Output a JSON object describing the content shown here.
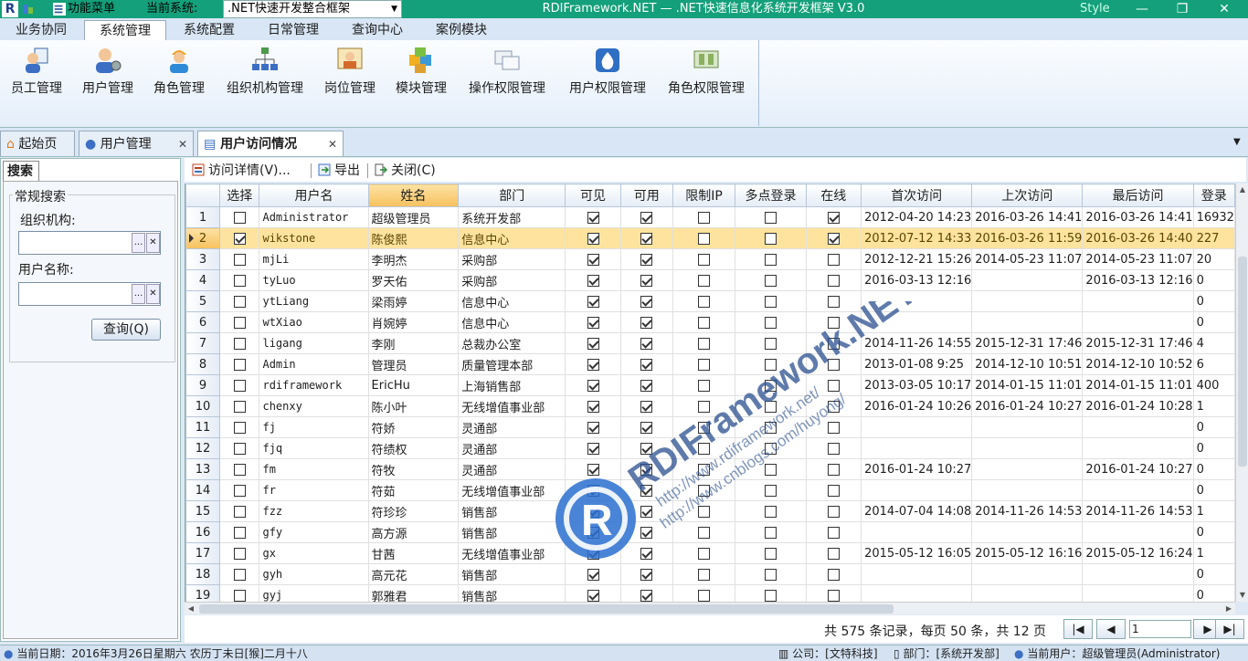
{
  "titlebar": {
    "app_logo": "R",
    "menu_label": "功能菜单",
    "current_system_label": "当前系统:",
    "current_system": ".NET快速开发整合框架",
    "window_title": "RDIFramework.NET — .NET快速信息化系统开发框架 V3.0",
    "style_label": "Style",
    "minimize": "—",
    "restore": "❐",
    "close": "✕"
  },
  "ribbon_tabs": [
    "业务协同",
    "系统管理",
    "系统配置",
    "日常管理",
    "查询中心",
    "案例模块"
  ],
  "ribbon_buttons": [
    "员工管理",
    "用户管理",
    "角色管理",
    "组织机构管理",
    "岗位管理",
    "模块管理",
    "操作权限管理",
    "用户权限管理",
    "角色权限管理"
  ],
  "doc_tabs": {
    "home": "起始页",
    "user_mgmt": "用户管理",
    "user_visit": "用户访问情况",
    "close": "✕",
    "more_arrow": "▼"
  },
  "left_panel": {
    "tab": "搜索",
    "group_title": "常规搜索",
    "org_label": "组织机构:",
    "user_label": "用户名称:",
    "ellipsis": "...",
    "clear": "✕",
    "query_button": "查询(Q)"
  },
  "toolbar": {
    "visit_detail": "访问详情(V)...",
    "export": "导出",
    "close": "关闭(C)"
  },
  "grid": {
    "columns": [
      "选择",
      "用户名",
      "姓名",
      "部门",
      "可见",
      "可用",
      "限制IP",
      "多点登录",
      "在线",
      "首次访问",
      "上次访问",
      "最后访问",
      "登录"
    ],
    "rows": [
      {
        "n": "1",
        "select": false,
        "username": "Administrator",
        "realname": "超级管理员",
        "dept": "系统开发部",
        "visible": true,
        "enabled": true,
        "limitip": false,
        "multi": false,
        "online": true,
        "first": "2012-04-20 14:23",
        "prev": "2016-03-26 14:41",
        "last": "2016-03-26 14:41",
        "logins": "16932"
      },
      {
        "n": "2",
        "select": true,
        "username": "wikstone",
        "realname": "陈俊熙",
        "dept": "信息中心",
        "visible": true,
        "enabled": true,
        "limitip": false,
        "multi": false,
        "online": true,
        "first": "2012-07-12 14:33",
        "prev": "2016-03-26 11:59",
        "last": "2016-03-26 14:40",
        "logins": "227"
      },
      {
        "n": "3",
        "select": false,
        "username": "mjLi",
        "realname": "李明杰",
        "dept": "采购部",
        "visible": true,
        "enabled": true,
        "limitip": false,
        "multi": false,
        "online": false,
        "first": "2012-12-21 15:26",
        "prev": "2014-05-23 11:07",
        "last": "2014-05-23 11:07",
        "logins": "20"
      },
      {
        "n": "4",
        "select": false,
        "username": "tyLuo",
        "realname": "罗天佑",
        "dept": "采购部",
        "visible": true,
        "enabled": true,
        "limitip": false,
        "multi": false,
        "online": false,
        "first": "2016-03-13 12:16",
        "prev": "",
        "last": "2016-03-13 12:16",
        "logins": "0"
      },
      {
        "n": "5",
        "select": false,
        "username": "ytLiang",
        "realname": "梁雨婷",
        "dept": "信息中心",
        "visible": true,
        "enabled": true,
        "limitip": false,
        "multi": false,
        "online": false,
        "first": "",
        "prev": "",
        "last": "",
        "logins": "0"
      },
      {
        "n": "6",
        "select": false,
        "username": "wtXiao",
        "realname": "肖婉婷",
        "dept": "信息中心",
        "visible": true,
        "enabled": true,
        "limitip": false,
        "multi": false,
        "online": false,
        "first": "",
        "prev": "",
        "last": "",
        "logins": "0"
      },
      {
        "n": "7",
        "select": false,
        "username": "ligang",
        "realname": "李刚",
        "dept": "总裁办公室",
        "visible": true,
        "enabled": true,
        "limitip": false,
        "multi": false,
        "online": false,
        "first": "2014-11-26 14:55",
        "prev": "2015-12-31 17:46",
        "last": "2015-12-31 17:46",
        "logins": "4"
      },
      {
        "n": "8",
        "select": false,
        "username": "Admin",
        "realname": "管理员",
        "dept": "质量管理本部",
        "visible": true,
        "enabled": true,
        "limitip": false,
        "multi": false,
        "online": false,
        "first": "2013-01-08 9:25",
        "prev": "2014-12-10 10:51",
        "last": "2014-12-10 10:52",
        "logins": "6"
      },
      {
        "n": "9",
        "select": false,
        "username": "rdiframework",
        "realname": "EricHu",
        "dept": "上海销售部",
        "visible": true,
        "enabled": true,
        "limitip": false,
        "multi": false,
        "online": false,
        "first": "2013-03-05 10:17",
        "prev": "2014-01-15 11:01",
        "last": "2014-01-15 11:01",
        "logins": "400"
      },
      {
        "n": "10",
        "select": false,
        "username": "chenxy",
        "realname": "陈小叶",
        "dept": "无线增值事业部",
        "visible": true,
        "enabled": true,
        "limitip": false,
        "multi": false,
        "online": false,
        "first": "2016-01-24 10:26",
        "prev": "2016-01-24 10:27",
        "last": "2016-01-24 10:28",
        "logins": "1"
      },
      {
        "n": "11",
        "select": false,
        "username": "fj",
        "realname": "符娇",
        "dept": "灵通部",
        "visible": true,
        "enabled": true,
        "limitip": false,
        "multi": false,
        "online": false,
        "first": "",
        "prev": "",
        "last": "",
        "logins": "0"
      },
      {
        "n": "12",
        "select": false,
        "username": "fjq",
        "realname": "符绩权",
        "dept": "灵通部",
        "visible": true,
        "enabled": true,
        "limitip": false,
        "multi": false,
        "online": false,
        "first": "",
        "prev": "",
        "last": "",
        "logins": "0"
      },
      {
        "n": "13",
        "select": false,
        "username": "fm",
        "realname": "符牧",
        "dept": "灵通部",
        "visible": true,
        "enabled": true,
        "limitip": false,
        "multi": false,
        "online": false,
        "first": "2016-01-24 10:27",
        "prev": "",
        "last": "2016-01-24 10:27",
        "logins": "0"
      },
      {
        "n": "14",
        "select": false,
        "username": "fr",
        "realname": "符茹",
        "dept": "无线增值事业部",
        "visible": true,
        "enabled": true,
        "limitip": false,
        "multi": false,
        "online": false,
        "first": "",
        "prev": "",
        "last": "",
        "logins": "0"
      },
      {
        "n": "15",
        "select": false,
        "username": "fzz",
        "realname": "符珍珍",
        "dept": "销售部",
        "visible": true,
        "enabled": true,
        "limitip": false,
        "multi": false,
        "online": false,
        "first": "2014-07-04 14:08",
        "prev": "2014-11-26 14:53",
        "last": "2014-11-26 14:53",
        "logins": "1"
      },
      {
        "n": "16",
        "select": false,
        "username": "gfy",
        "realname": "高方源",
        "dept": "销售部",
        "visible": true,
        "enabled": true,
        "limitip": false,
        "multi": false,
        "online": false,
        "first": "",
        "prev": "",
        "last": "",
        "logins": "0"
      },
      {
        "n": "17",
        "select": false,
        "username": "gx",
        "realname": "甘茜",
        "dept": "无线增值事业部",
        "visible": true,
        "enabled": true,
        "limitip": false,
        "multi": false,
        "online": false,
        "first": "2015-05-12 16:05",
        "prev": "2015-05-12 16:16",
        "last": "2015-05-12 16:24",
        "logins": "1"
      },
      {
        "n": "18",
        "select": false,
        "username": "gyh",
        "realname": "高元花",
        "dept": "销售部",
        "visible": true,
        "enabled": true,
        "limitip": false,
        "multi": false,
        "online": false,
        "first": "",
        "prev": "",
        "last": "",
        "logins": "0"
      },
      {
        "n": "19",
        "select": false,
        "username": "gyj",
        "realname": "郭雅君",
        "dept": "销售部",
        "visible": true,
        "enabled": true,
        "limitip": false,
        "multi": false,
        "online": false,
        "first": "",
        "prev": "",
        "last": "",
        "logins": "0"
      }
    ]
  },
  "pager": {
    "summary": "共 575 条记录，每页 50 条，共 12 页",
    "first": "|◀",
    "prev": "◀",
    "page": "1",
    "next": "▶",
    "last": "▶|"
  },
  "statusbar": {
    "date": "当前日期：2016年3月26日星期六 农历丁未日[猴]二月十八",
    "company": "公司：[文特科技]",
    "department": "部门：[系统开发部]",
    "current_user": "当前用户：超级管理员(Administrator)"
  },
  "watermark": {
    "brand": "RDIFramework.NET",
    "url1": "http://www.rdiframework.net/",
    "url2": "http://www.cnblogs.com/huyong/"
  },
  "colors": {
    "titlebar": "#13a07a",
    "ribbon": "#d8e6f5",
    "selected_row": "#fde39e",
    "sorted_header": "#f6c15e"
  }
}
